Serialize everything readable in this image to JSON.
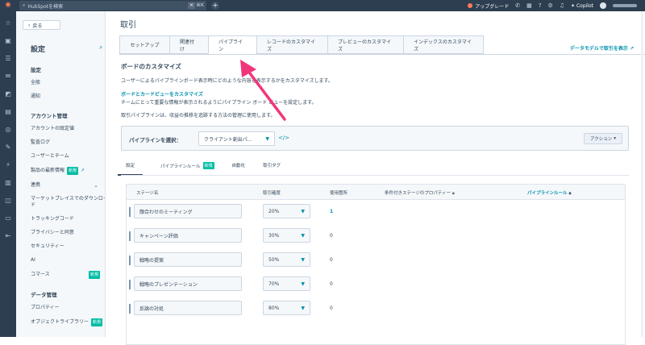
{
  "topbar": {
    "search_placeholder": "HubSpotを検索",
    "search_kbd": "⌘K",
    "upgrade_label": "アップグレード",
    "copilot_label": "Copilot"
  },
  "settings_panel": {
    "back_label": "戻る",
    "title": "設定",
    "sections": [
      {
        "heading": "設定",
        "items": [
          {
            "label": "全般"
          },
          {
            "label": "通知"
          }
        ]
      },
      {
        "heading": "アカウント管理",
        "items": [
          {
            "label": "アカウントの既定値"
          },
          {
            "label": "監査ログ"
          },
          {
            "label": "ユーザーとチーム"
          },
          {
            "label": "製品の最新情報",
            "badge": "新規"
          },
          {
            "label": "連携"
          },
          {
            "label": "マーケットプレイスでのダウンロード"
          },
          {
            "label": "トラッキングコード"
          },
          {
            "label": "プライバシーと同意"
          },
          {
            "label": "セキュリティー"
          },
          {
            "label": "AI"
          },
          {
            "label": "コマース",
            "badge": "新規"
          }
        ]
      },
      {
        "heading": "データ管理",
        "items": [
          {
            "label": "プロパティー"
          },
          {
            "label": "オブジェクトライブラリー",
            "badge": "新規"
          }
        ]
      }
    ]
  },
  "main": {
    "page_title": "取引",
    "tabs": [
      {
        "label": "セットアップ"
      },
      {
        "label": "関連付け"
      },
      {
        "label": "パイプライン",
        "active": true
      },
      {
        "label": "レコードのカスタマイズ"
      },
      {
        "label": "プレビューのカスタマイズ"
      },
      {
        "label": "インデックスのカスタマイズ"
      }
    ],
    "data_model_link": "データモデルで取引を表示",
    "section_heading": "ボードのカスタマイズ",
    "description": "ユーザーによるパイプラインボード表示時にどのような内容を表示するかをカスタマイズします。",
    "board_link": "ボードとカードビューをカスタマイズ",
    "board_desc": "チームにとって重要な情報が表示されるようにパイプライン ボード ビューを設定します。",
    "pipeline_desc": "取引パイプラインは、収益の推移を追跡する方法の管理に使用します。",
    "pipeline_label": "パイプラインを選択：",
    "pipeline_value": "クライアント創出パ...",
    "action_label": "アクション",
    "subtabs": [
      {
        "label": "設定",
        "active": true
      },
      {
        "label": "パイプラインルール",
        "badge": "新規"
      },
      {
        "label": "自動化"
      },
      {
        "label": "取引タグ"
      }
    ],
    "table": {
      "headers": {
        "stage": "ステージ名",
        "probability": "取引確度",
        "usage": "使用箇所",
        "conditional": "条件付きステージのプロパティー",
        "rules": "パイプラインルール"
      },
      "rows": [
        {
          "stage": "顔合わせのミーティング",
          "probability": "20%",
          "usage": "1"
        },
        {
          "stage": "キャンペーン評価",
          "probability": "30%",
          "usage": "0"
        },
        {
          "stage": "戦略の提案",
          "probability": "50%",
          "usage": "0"
        },
        {
          "stage": "戦略のプレゼンテーション",
          "probability": "70%",
          "usage": "0"
        },
        {
          "stage": "反論の対処",
          "probability": "80%",
          "usage": "0"
        }
      ]
    }
  },
  "colors": {
    "nav_dark": "#2d3e50",
    "link": "#0091ae",
    "badge": "#00bda5",
    "annotation_arrow": "#f2357a"
  }
}
